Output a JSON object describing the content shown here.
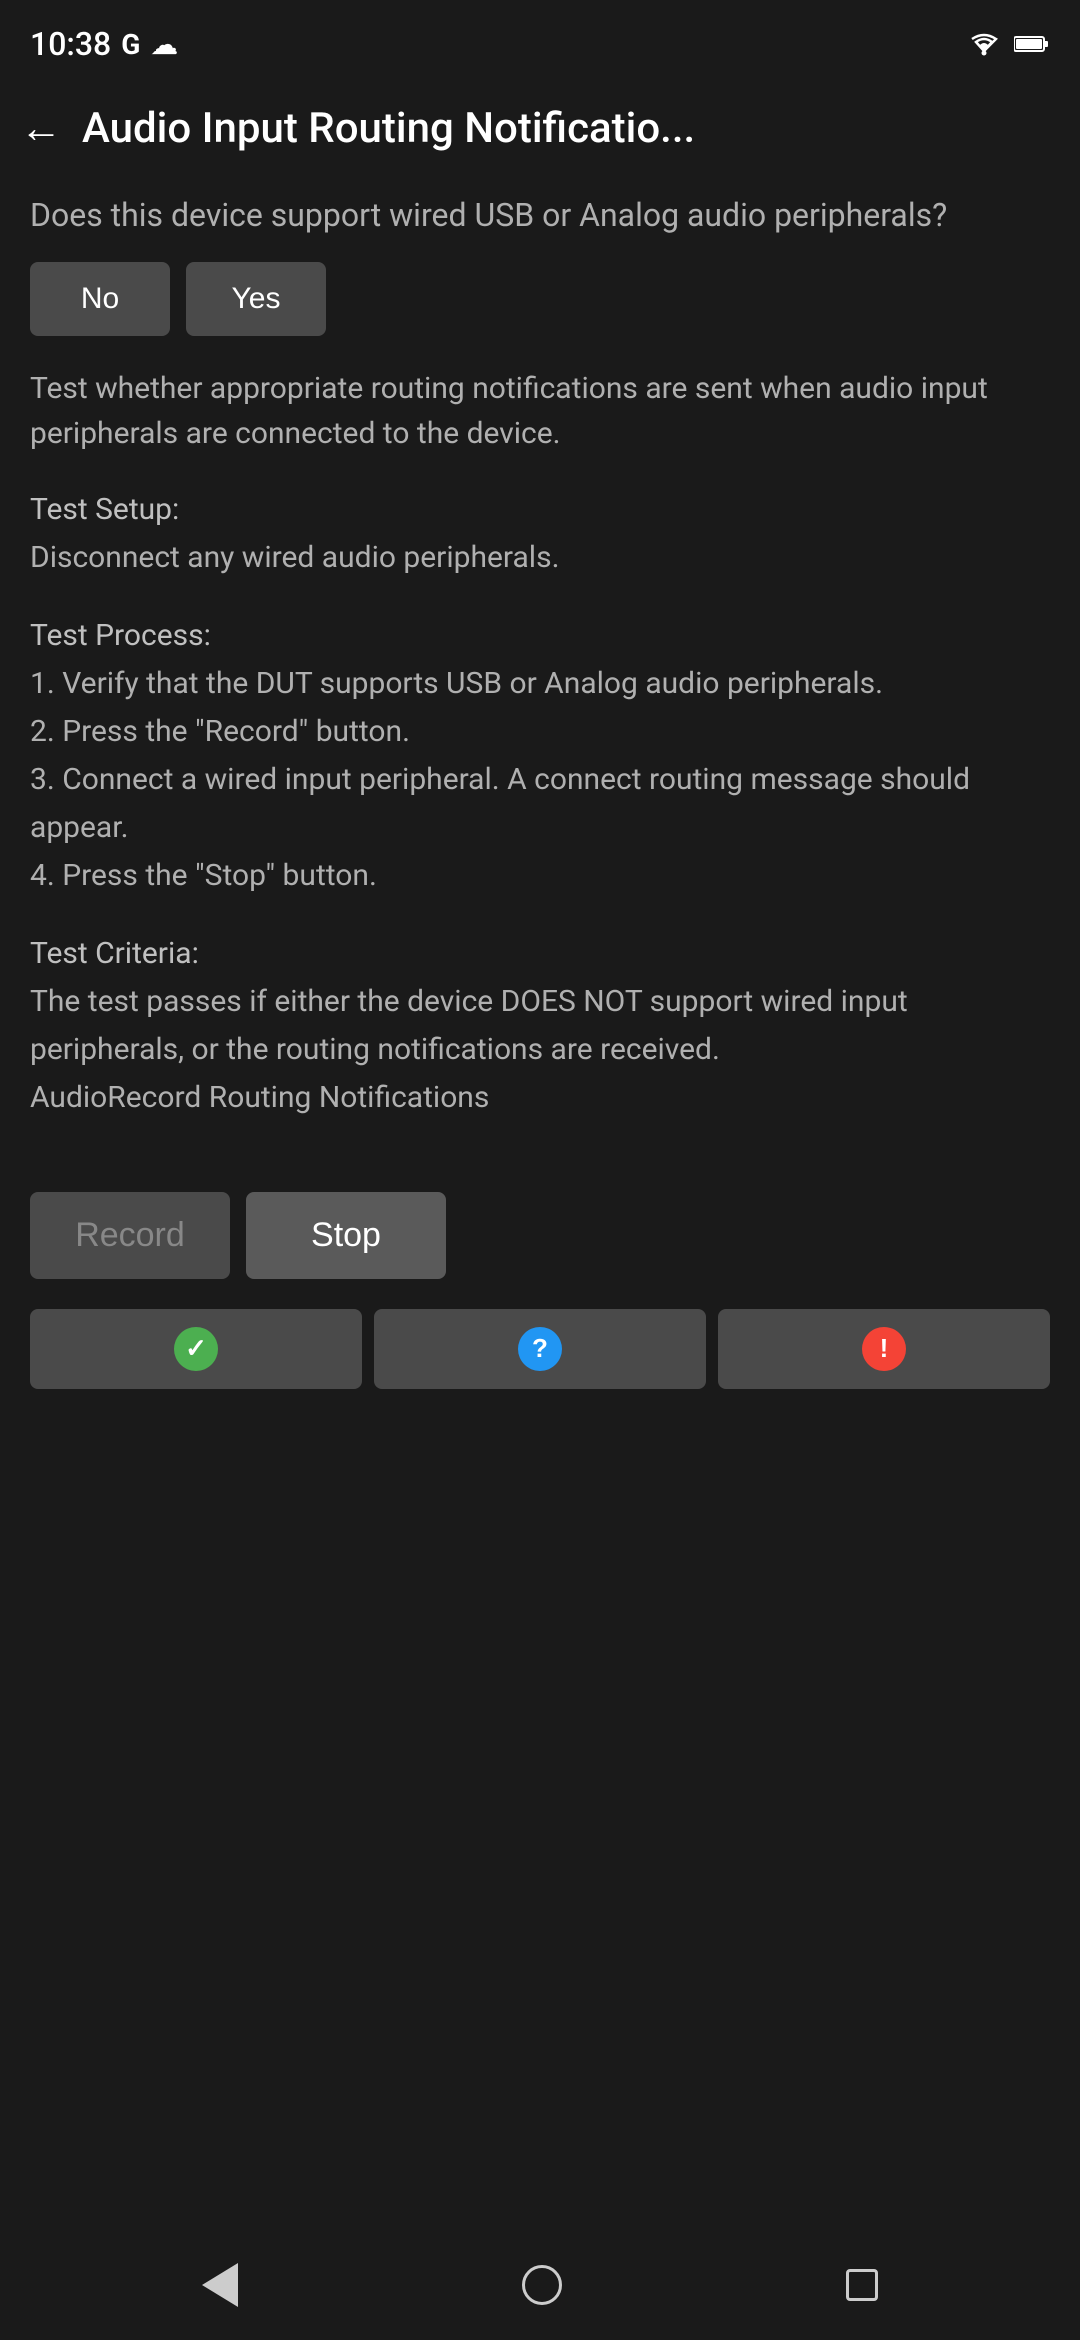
{
  "statusBar": {
    "time": "10:38",
    "googleIcon": "G",
    "cloudIcon": "☁"
  },
  "header": {
    "backLabel": "←",
    "title": "Audio Input Routing Notificatio..."
  },
  "content": {
    "questionText": "Does this device support wired USB or Analog audio peripherals?",
    "noButtonLabel": "No",
    "yesButtonLabel": "Yes",
    "descriptionText": "Test whether appropriate routing notifications are sent when audio input peripherals are connected to the device.",
    "testSetup": {
      "title": "Test Setup:",
      "body": "Disconnect any wired audio peripherals."
    },
    "testProcess": {
      "title": "Test Process:",
      "steps": [
        "1. Verify that the DUT supports USB or Analog audio peripherals.",
        "2. Press the \"Record\" button.",
        "3. Connect a wired input peripheral. A connect routing message should appear.",
        "4. Press the \"Stop\" button."
      ]
    },
    "testCriteria": {
      "title": "Test Criteria:",
      "body": "The test passes if either the device DOES NOT support wired input peripherals, or the routing notifications are received.",
      "label": "AudioRecord Routing Notifications"
    }
  },
  "actionButtons": {
    "recordLabel": "Record",
    "stopLabel": "Stop"
  },
  "resultButtons": {
    "passIcon": "✓",
    "infoIcon": "?",
    "failIcon": "!"
  },
  "navBar": {
    "backTitle": "back",
    "homeTitle": "home",
    "recentTitle": "recent"
  }
}
